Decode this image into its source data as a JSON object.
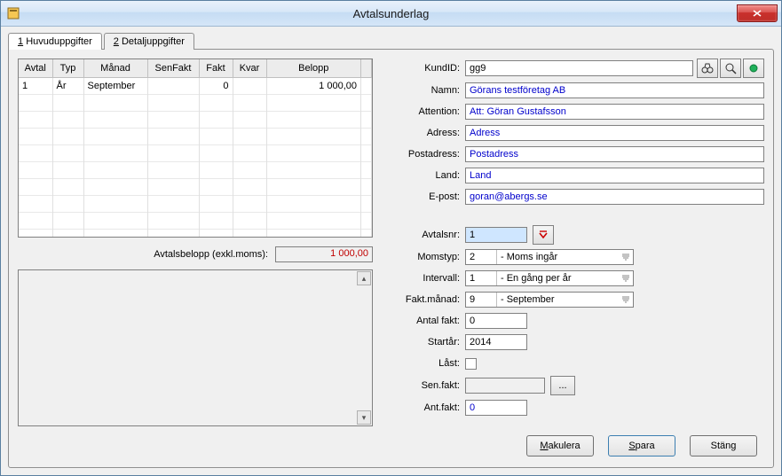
{
  "window": {
    "title": "Avtalsunderlag"
  },
  "tabs": {
    "main_number": "1",
    "main_label": "Huvuduppgifter",
    "detail_number": "2",
    "detail_label": "Detaljuppgifter"
  },
  "grid": {
    "headers": {
      "avtal": "Avtal",
      "typ": "Typ",
      "manad": "Månad",
      "senfakt": "SenFakt",
      "fakt": "Fakt",
      "kvar": "Kvar",
      "belopp": "Belopp"
    },
    "rows": [
      {
        "avtal": "1",
        "typ": "År",
        "manad": "September",
        "senfakt": "",
        "fakt": "0",
        "kvar": "",
        "belopp": "1 000,00"
      }
    ]
  },
  "summary": {
    "label": "Avtalsbelopp (exkl.moms):",
    "value": "1 000,00"
  },
  "customer": {
    "kundid_label": "KundID:",
    "kundid_value": "gg9",
    "namn_label": "Namn:",
    "namn_value": "Görans testföretag AB",
    "attention_label": "Attention:",
    "attention_value": "Att: Göran Gustafsson",
    "adress_label": "Adress:",
    "adress_value": "Adress",
    "postadress_label": "Postadress:",
    "postadress_value": "Postadress",
    "land_label": "Land:",
    "land_value": "Land",
    "epost_label": "E-post:",
    "epost_value": "goran@abergs.se"
  },
  "contract": {
    "avtalsnr_label": "Avtalsnr:",
    "avtalsnr_value": "1",
    "momstyp_label": "Momstyp:",
    "momstyp_code": "2",
    "momstyp_text": "- Moms ingår",
    "intervall_label": "Intervall:",
    "intervall_code": "1",
    "intervall_text": "- En gång per år",
    "faktmanad_label": "Fakt.månad:",
    "faktmanad_code": "9",
    "faktmanad_text": "- September",
    "antalfakt_label": "Antal fakt:",
    "antalfakt_value": "0",
    "startar_label": "Startår:",
    "startar_value": "2014",
    "last_label": "Låst:",
    "senfakt_label": "Sen.fakt:",
    "senfakt_value": "",
    "senfakt_btn": "...",
    "antfakt_label": "Ant.fakt:",
    "antfakt_value": "0"
  },
  "buttons": {
    "makulera": "Makulera",
    "spara": "Spara",
    "stang": "Stäng"
  },
  "icons": {
    "app": "app-icon",
    "close": "close-icon",
    "binoculars": "binoculars-icon",
    "magnifier": "magnifier-icon",
    "newrecord": "new-record-icon",
    "arrowdown": "arrow-down-icon"
  }
}
